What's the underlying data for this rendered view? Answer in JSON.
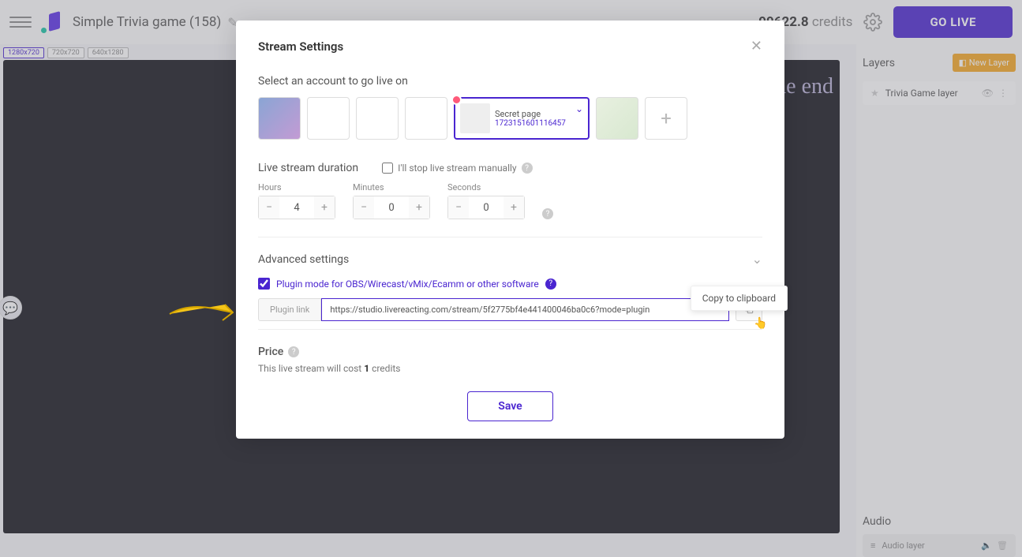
{
  "header": {
    "project_title": "Simple Trivia game (158)",
    "credits_value": "99622.8",
    "credits_label": "credits",
    "golive": "GO LIVE"
  },
  "resolutions": [
    "1280x720",
    "720x720",
    "640x1280"
  ],
  "stage": {
    "gameend": "ame end"
  },
  "layers": {
    "title": "Layers",
    "new_layer": "New Layer",
    "items": [
      {
        "name": "Trivia Game layer"
      }
    ]
  },
  "audio": {
    "title": "Audio",
    "items": [
      {
        "name": "Audio layer"
      }
    ]
  },
  "modal": {
    "title": "Stream Settings",
    "select_account": "Select an account to go live on",
    "selected_account": {
      "name": "Secret page",
      "id": "1723151601116457"
    },
    "duration_title": "Live stream duration",
    "manual_label": "I'll stop live stream manually",
    "hours_label": "Hours",
    "hours_value": "4",
    "minutes_label": "Minutes",
    "minutes_value": "0",
    "seconds_label": "Seconds",
    "seconds_value": "0",
    "advanced_title": "Advanced settings",
    "plugin_label": "Plugin mode for OBS/Wirecast/vMix/Ecamm or other software",
    "plugin_link_label": "Plugin link",
    "plugin_link_value": "https://studio.livereacting.com/stream/5f2775bf4e441400046ba0c6?mode=plugin",
    "tooltip": "Copy to clipboard",
    "price_title": "Price",
    "price_text_pre": "This live stream will cost ",
    "price_value": "1",
    "price_text_post": " credits",
    "save": "Save"
  }
}
